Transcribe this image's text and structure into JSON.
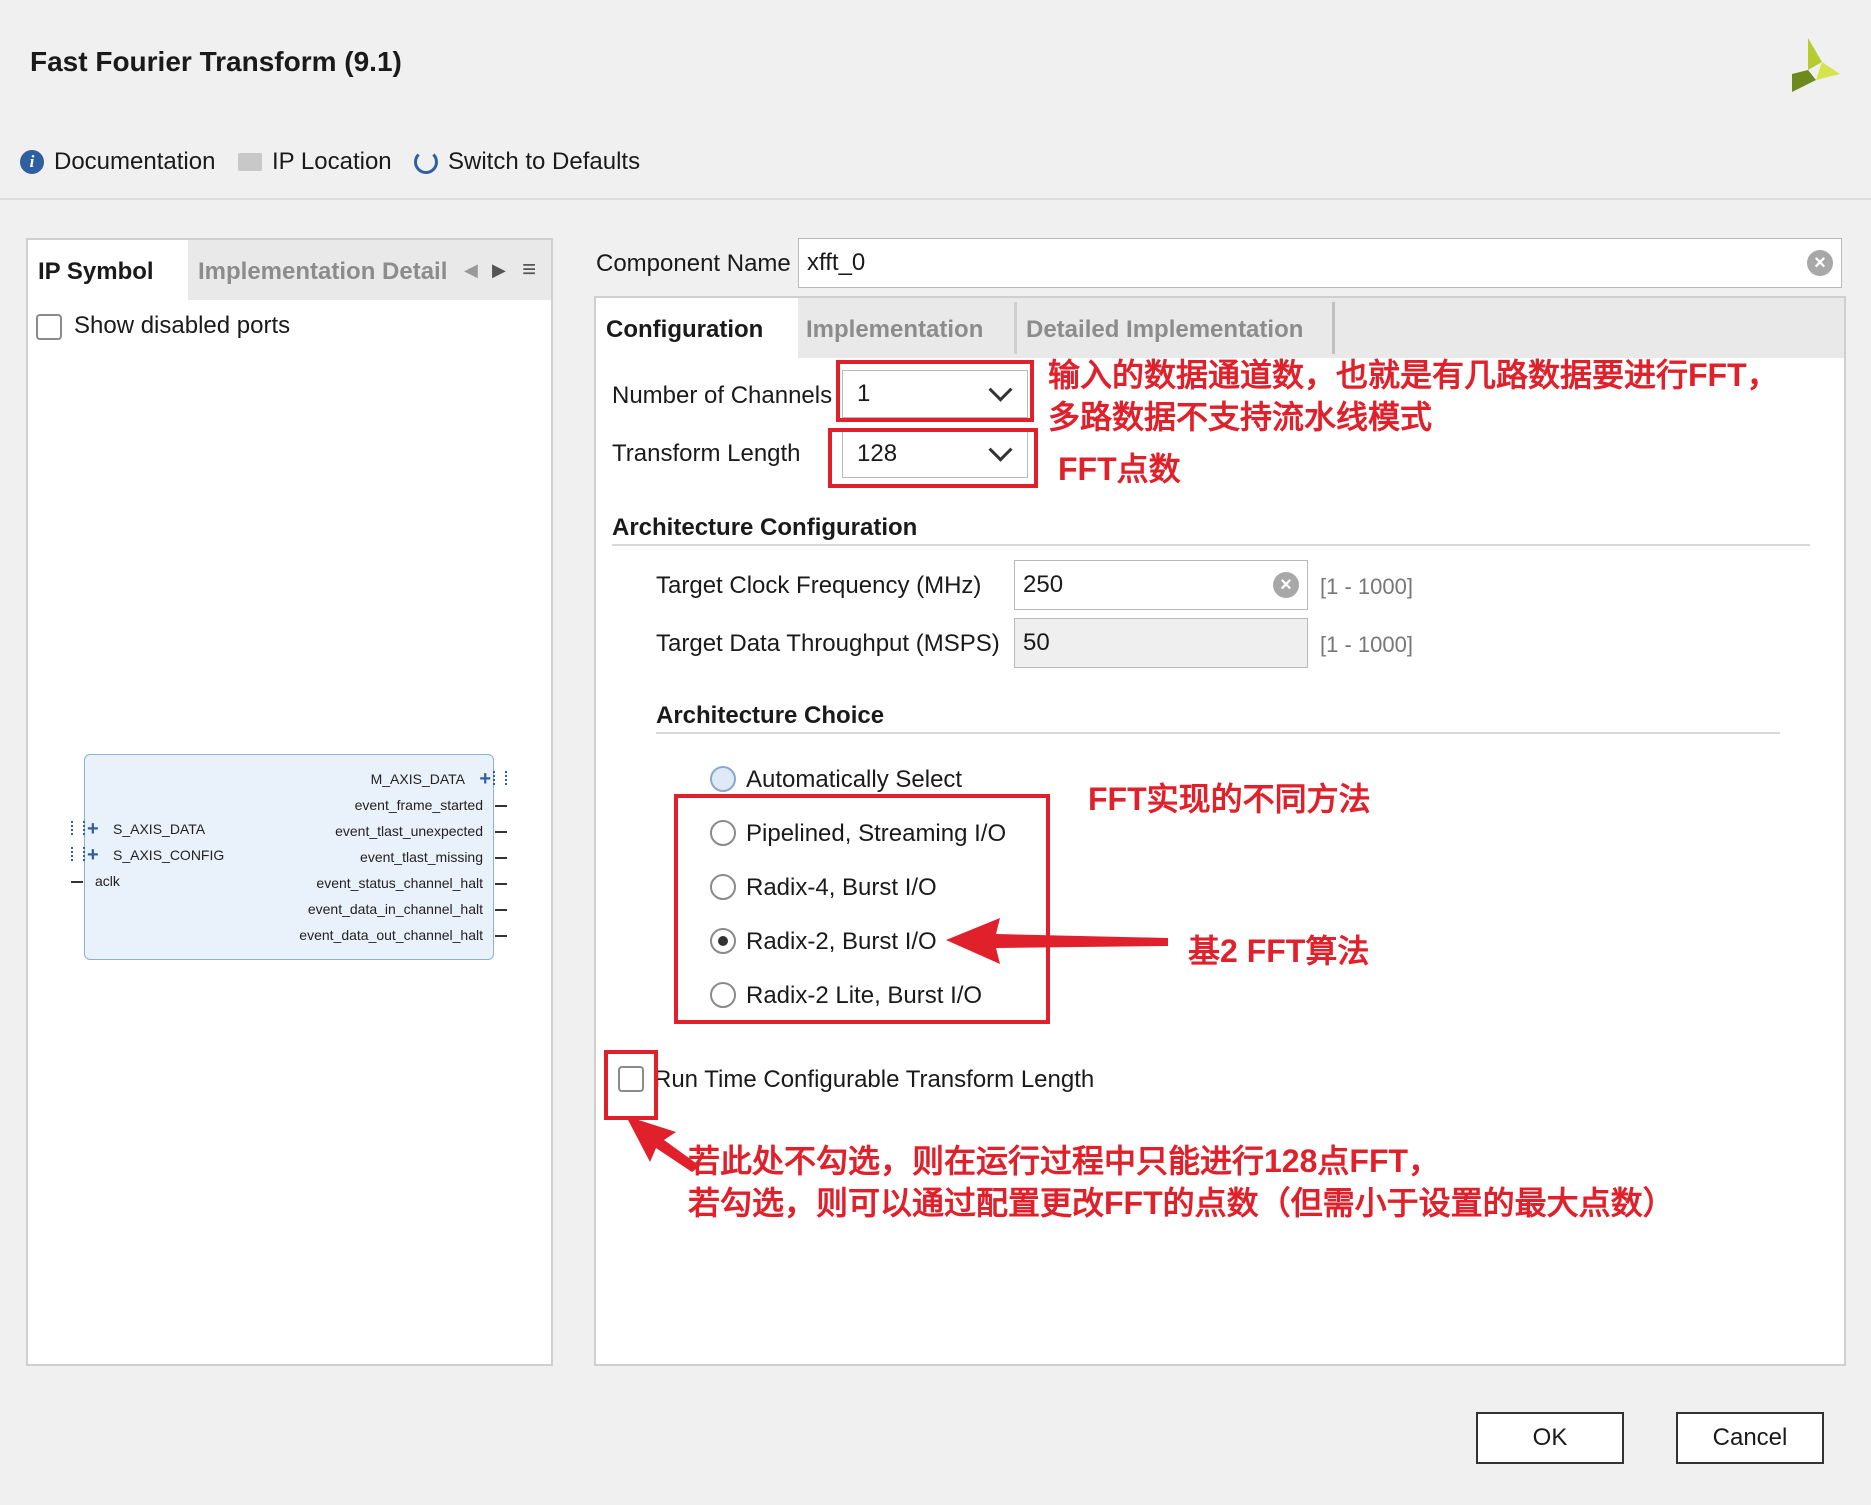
{
  "window": {
    "title": "Fast Fourier Transform (9.1)"
  },
  "toolbar": {
    "documentation": "Documentation",
    "ip_location": "IP Location",
    "switch_defaults": "Switch to Defaults"
  },
  "left_panel": {
    "tabs": [
      "IP Symbol",
      "Implementation Detail"
    ],
    "show_disabled_ports": "Show disabled ports",
    "symbol": {
      "left_ports": [
        "S_AXIS_DATA",
        "S_AXIS_CONFIG",
        "aclk"
      ],
      "right_ports": [
        "M_AXIS_DATA",
        "event_frame_started",
        "event_tlast_unexpected",
        "event_tlast_missing",
        "event_status_channel_halt",
        "event_data_in_channel_halt",
        "event_data_out_channel_halt"
      ]
    }
  },
  "component": {
    "label": "Component Name",
    "value": "xfft_0"
  },
  "config_tabs": [
    "Configuration",
    "Implementation",
    "Detailed Implementation"
  ],
  "config": {
    "channels_label": "Number of Channels",
    "channels_value": "1",
    "transform_label": "Transform Length",
    "transform_value": "128",
    "arch_config_title": "Architecture Configuration",
    "clock_label": "Target Clock Frequency (MHz)",
    "clock_value": "250",
    "clock_range": "[1 - 1000]",
    "throughput_label": "Target Data Throughput (MSPS)",
    "throughput_value": "50",
    "throughput_range": "[1 - 1000]",
    "arch_choice_title": "Architecture Choice",
    "arch_options": [
      "Automatically Select",
      "Pipelined, Streaming I/O",
      "Radix-4, Burst I/O",
      "Radix-2, Burst I/O",
      "Radix-2 Lite, Burst I/O"
    ],
    "arch_selected": "Radix-2, Burst I/O",
    "runtime_label": "Run Time Configurable Transform Length"
  },
  "annotations": {
    "channels_line1": "输入的数据通道数，也就是有几路数据要进行FFT，",
    "channels_line2": "多路数据不支持流水线模式",
    "fft_points": "FFT点数",
    "methods": "FFT实现的不同方法",
    "radix2": "基2 FFT算法",
    "runtime_line1": "若此处不勾选，则在运行过程中只能进行128点FFT，",
    "runtime_line2": "若勾选，则可以通过配置更改FFT的点数（但需小于设置的最大点数）"
  },
  "buttons": {
    "ok": "OK",
    "cancel": "Cancel"
  },
  "colors": {
    "annotation_red": "#e0202a",
    "accent_blue": "#2f5fa0"
  }
}
